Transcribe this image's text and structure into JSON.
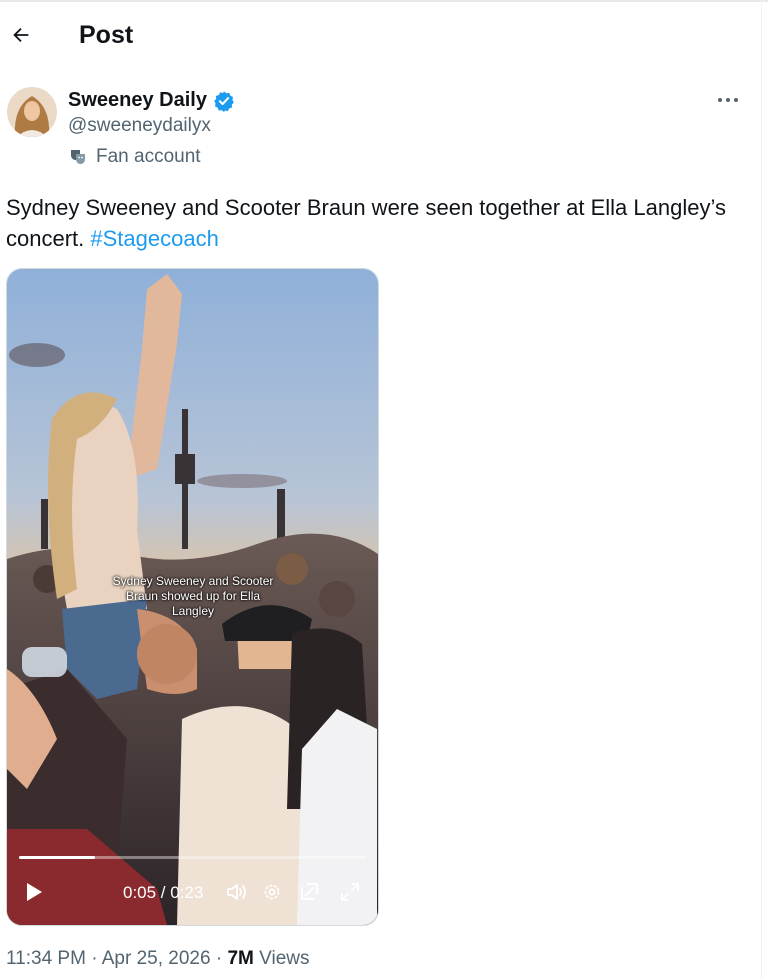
{
  "header": {
    "title": "Post"
  },
  "author": {
    "name": "Sweeney Daily",
    "handle": "@sweeneydailyx",
    "label": "Fan account"
  },
  "post": {
    "text": "Sydney Sweeney and Scooter Braun were seen together at Ella Langley’s concert. ",
    "hashtag": "#Stagecoach"
  },
  "video": {
    "caption": "Sydney Sweeney and Scooter Braun showed up for Ella Langley",
    "time": "0:05 / 0:23",
    "progress": 0.22
  },
  "meta": {
    "timestamp": "11:34 PM · Apr 25, 2026 · ",
    "views_count": "7M",
    "views_label": " Views"
  },
  "colors": {
    "accent": "#1d9bf0",
    "secondary_text": "#536471"
  }
}
